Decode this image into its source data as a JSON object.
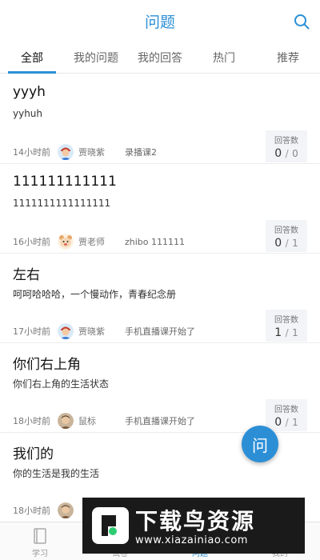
{
  "header": {
    "title": "问题"
  },
  "tabs": [
    {
      "label": "全部",
      "active": true
    },
    {
      "label": "我的问题",
      "active": false
    },
    {
      "label": "我的回答",
      "active": false
    },
    {
      "label": "热门",
      "active": false
    },
    {
      "label": "推荐",
      "active": false
    }
  ],
  "answers_label": "回答数",
  "questions": [
    {
      "title": "yyyh",
      "desc": "yyhuh",
      "time": "14小时前",
      "user": "贾晓紫",
      "course": "录播课2",
      "answered": "0",
      "sep": "/",
      "total": "0",
      "avatar": "person"
    },
    {
      "title": "111111111111",
      "desc": "1111111111111111",
      "time": "16小时前",
      "user": "贾老师",
      "course": "zhibo 111111",
      "answered": "0",
      "sep": "/",
      "total": "1",
      "avatar": "cartoon"
    },
    {
      "title": "左右",
      "desc": "呵呵哈哈哈，一个慢动作，青春纪念册",
      "time": "17小时前",
      "user": "贾晓紫",
      "course": "手机直播课开始了",
      "answered": "1",
      "sep": "/",
      "total": "1",
      "avatar": "person"
    },
    {
      "title": "你们右上角",
      "desc": "你们右上角的生活状态",
      "time": "18小时前",
      "user": "鼠标",
      "course": "手机直播课开始了",
      "answered": "0",
      "sep": "/",
      "total": "1",
      "avatar": "kid"
    },
    {
      "title": "我们的",
      "desc": "你的生活是我的生活",
      "time": "18小时前",
      "user": "",
      "course": "",
      "answered": "",
      "sep": "",
      "total": "",
      "avatar": "kid"
    }
  ],
  "fab": {
    "label": "问"
  },
  "bottom_nav": [
    {
      "label": "学习",
      "active": false
    },
    {
      "label": "试卷",
      "active": false
    },
    {
      "label": "问题",
      "active": true
    },
    {
      "label": "我的",
      "active": false
    }
  ],
  "watermark": {
    "text": "下载鸟资源",
    "url": "www.xiazainiao.com"
  },
  "colors": {
    "accent": "#2c8fd6",
    "fab": "#2c8fd6",
    "watermark_bg": "#1a1a1a"
  }
}
